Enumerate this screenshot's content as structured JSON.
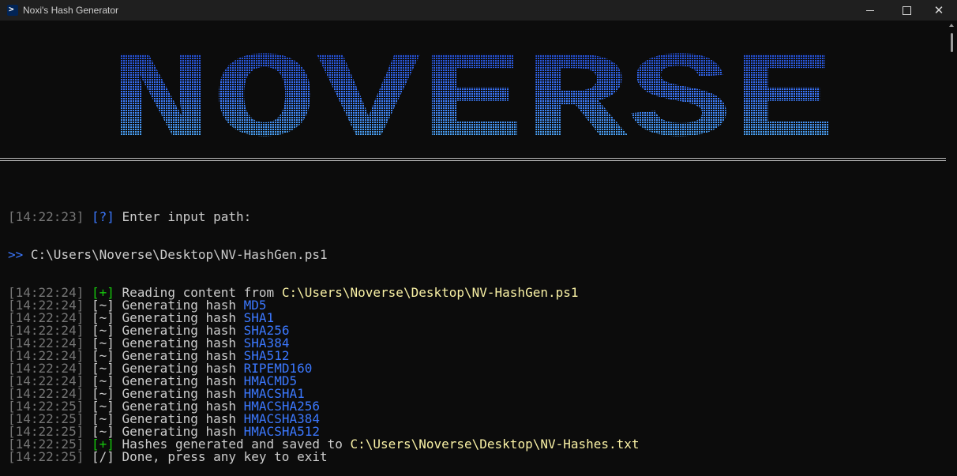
{
  "window": {
    "title": "Noxi's Hash Generator",
    "icon": "powershell-icon",
    "controls": [
      "minimize",
      "maximize",
      "close"
    ]
  },
  "banner": {
    "text": "NOVERSE",
    "gradient": [
      "#0f2aa8",
      "#3b78ff",
      "#61d6d6"
    ]
  },
  "prompt": {
    "time": "[14:22:23]",
    "marker": "[?]",
    "text": "Enter input path:",
    "input_prefix": ">>",
    "input_value": "C:\\Users\\Noverse\\Desktop\\NV-HashGen.ps1"
  },
  "lines": [
    {
      "time": "[14:22:24]",
      "marker": "[+]",
      "text": "Reading content from",
      "value": "C:\\Users\\Noverse\\Desktop\\NV-HashGen.ps1",
      "kind": "path"
    },
    {
      "time": "[14:22:24]",
      "marker": "[~]",
      "text": "Generating hash",
      "value": "MD5",
      "kind": "hash"
    },
    {
      "time": "[14:22:24]",
      "marker": "[~]",
      "text": "Generating hash",
      "value": "SHA1",
      "kind": "hash"
    },
    {
      "time": "[14:22:24]",
      "marker": "[~]",
      "text": "Generating hash",
      "value": "SHA256",
      "kind": "hash"
    },
    {
      "time": "[14:22:24]",
      "marker": "[~]",
      "text": "Generating hash",
      "value": "SHA384",
      "kind": "hash"
    },
    {
      "time": "[14:22:24]",
      "marker": "[~]",
      "text": "Generating hash",
      "value": "SHA512",
      "kind": "hash"
    },
    {
      "time": "[14:22:24]",
      "marker": "[~]",
      "text": "Generating hash",
      "value": "RIPEMD160",
      "kind": "hash"
    },
    {
      "time": "[14:22:24]",
      "marker": "[~]",
      "text": "Generating hash",
      "value": "HMACMD5",
      "kind": "hash"
    },
    {
      "time": "[14:22:24]",
      "marker": "[~]",
      "text": "Generating hash",
      "value": "HMACSHA1",
      "kind": "hash"
    },
    {
      "time": "[14:22:25]",
      "marker": "[~]",
      "text": "Generating hash",
      "value": "HMACSHA256",
      "kind": "hash"
    },
    {
      "time": "[14:22:25]",
      "marker": "[~]",
      "text": "Generating hash",
      "value": "HMACSHA384",
      "kind": "hash"
    },
    {
      "time": "[14:22:25]",
      "marker": "[~]",
      "text": "Generating hash",
      "value": "HMACSHA512",
      "kind": "hash"
    },
    {
      "time": "[14:22:25]",
      "marker": "[+]",
      "text": "Hashes generated and saved to",
      "value": "C:\\Users\\Noverse\\Desktop\\NV-Hashes.txt",
      "kind": "path"
    },
    {
      "time": "[14:22:25]",
      "marker": "[/]",
      "text": "Done, press any key to exit",
      "value": "",
      "kind": "plain"
    }
  ]
}
